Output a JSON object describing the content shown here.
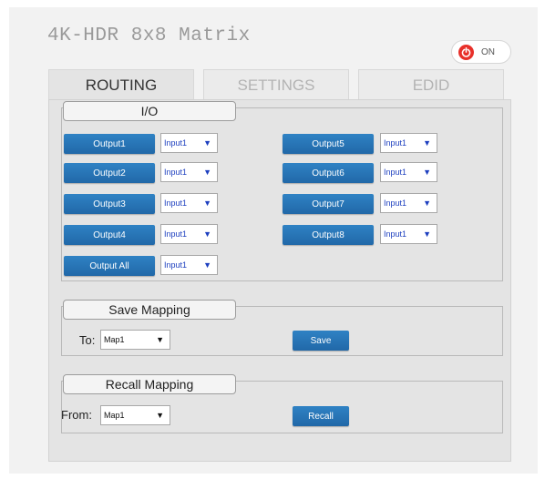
{
  "app": {
    "title": "4K-HDR 8x8 Matrix"
  },
  "power": {
    "label": "ON",
    "icon": "power-icon",
    "icon_color": "#e8302a"
  },
  "tabs": [
    {
      "label": "ROUTING",
      "active": true
    },
    {
      "label": "SETTINGS",
      "active": false
    },
    {
      "label": "EDID",
      "active": false
    }
  ],
  "io": {
    "legend": "I/O",
    "outputs": [
      {
        "label": "Output1",
        "value": "Input1"
      },
      {
        "label": "Output2",
        "value": "Input1"
      },
      {
        "label": "Output3",
        "value": "Input1"
      },
      {
        "label": "Output4",
        "value": "Input1"
      },
      {
        "label": "Output5",
        "value": "Input1"
      },
      {
        "label": "Output6",
        "value": "Input1"
      },
      {
        "label": "Output7",
        "value": "Input1"
      },
      {
        "label": "Output8",
        "value": "Input1"
      }
    ],
    "output_all": {
      "label": "Output All",
      "value": "Input1"
    }
  },
  "save_mapping": {
    "legend": "Save Mapping",
    "to_label": "To:",
    "map_value": "Map1",
    "button_label": "Save"
  },
  "recall_mapping": {
    "legend": "Recall Mapping",
    "from_label": "From:",
    "map_value": "Map1",
    "button_label": "Recall"
  },
  "colors": {
    "button_blue": "#2a78bb",
    "select_text_blue": "#1d3fbf",
    "power_red": "#e8302a"
  }
}
